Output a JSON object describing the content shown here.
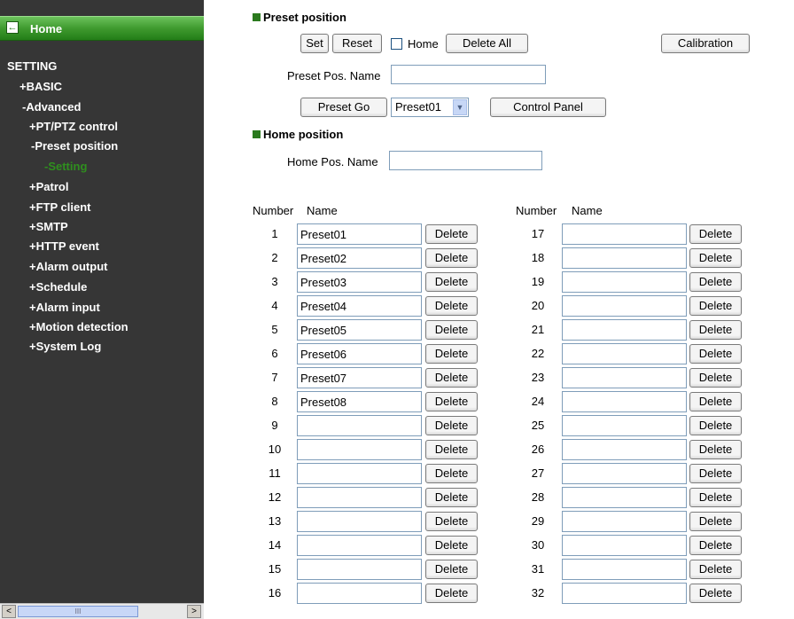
{
  "sidebar": {
    "home_label": "Home",
    "items": [
      {
        "label": "SETTING"
      },
      {
        "label": "+BASIC"
      },
      {
        "label": "-Advanced"
      },
      {
        "label": "+PT/PTZ control"
      },
      {
        "label": "-Preset position"
      },
      {
        "label": "-Setting"
      },
      {
        "label": "+Patrol"
      },
      {
        "label": "+FTP client"
      },
      {
        "label": "+SMTP"
      },
      {
        "label": "+HTTP event"
      },
      {
        "label": "+Alarm output"
      },
      {
        "label": "+Schedule"
      },
      {
        "label": "+Alarm input"
      },
      {
        "label": "+Motion detection"
      },
      {
        "label": "+System Log"
      }
    ],
    "scroll_left": "<",
    "scroll_right": ">",
    "scroll_grip": "III"
  },
  "preset": {
    "title": "Preset position",
    "set_label": "Set",
    "reset_label": "Reset",
    "home_checkbox_label": "Home",
    "home_checked": false,
    "delete_all_label": "Delete All",
    "calibration_label": "Calibration",
    "name_label": "Preset Pos. Name",
    "name_value": "",
    "go_label": "Preset Go",
    "select_value": "Preset01",
    "control_panel_label": "Control Panel"
  },
  "home": {
    "title": "Home position",
    "name_label": "Home Pos. Name",
    "name_value": ""
  },
  "table": {
    "number_header": "Number",
    "name_header": "Name",
    "delete_label": "Delete",
    "left": [
      {
        "num": "1",
        "name": "Preset01"
      },
      {
        "num": "2",
        "name": "Preset02"
      },
      {
        "num": "3",
        "name": "Preset03"
      },
      {
        "num": "4",
        "name": "Preset04"
      },
      {
        "num": "5",
        "name": "Preset05"
      },
      {
        "num": "6",
        "name": "Preset06"
      },
      {
        "num": "7",
        "name": "Preset07"
      },
      {
        "num": "8",
        "name": "Preset08"
      },
      {
        "num": "9",
        "name": ""
      },
      {
        "num": "10",
        "name": ""
      },
      {
        "num": "11",
        "name": ""
      },
      {
        "num": "12",
        "name": ""
      },
      {
        "num": "13",
        "name": ""
      },
      {
        "num": "14",
        "name": ""
      },
      {
        "num": "15",
        "name": ""
      },
      {
        "num": "16",
        "name": ""
      }
    ],
    "right": [
      {
        "num": "17",
        "name": ""
      },
      {
        "num": "18",
        "name": ""
      },
      {
        "num": "19",
        "name": ""
      },
      {
        "num": "20",
        "name": ""
      },
      {
        "num": "21",
        "name": ""
      },
      {
        "num": "22",
        "name": ""
      },
      {
        "num": "23",
        "name": ""
      },
      {
        "num": "24",
        "name": ""
      },
      {
        "num": "25",
        "name": ""
      },
      {
        "num": "26",
        "name": ""
      },
      {
        "num": "27",
        "name": ""
      },
      {
        "num": "28",
        "name": ""
      },
      {
        "num": "29",
        "name": ""
      },
      {
        "num": "30",
        "name": ""
      },
      {
        "num": "31",
        "name": ""
      },
      {
        "num": "32",
        "name": ""
      }
    ]
  },
  "colors": {
    "sidebar_bg": "#363636",
    "accent_green": "#2b7a1e",
    "active_item": "#2f8f1e"
  }
}
